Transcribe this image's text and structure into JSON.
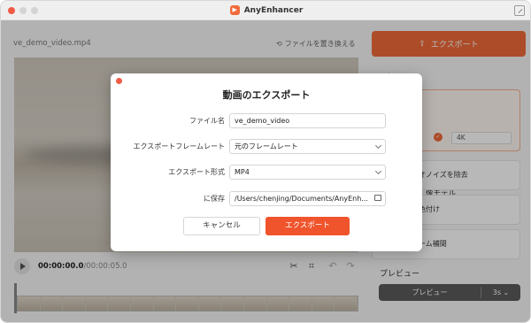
{
  "window": {
    "app_title": "AnyEnhancer",
    "colors": {
      "close": "#f15a47",
      "minimize": "#d4d4d4",
      "maximize": "#d4d4d4",
      "accent": "#f06a3a"
    }
  },
  "editor": {
    "file_name": "ve_demo_video.mp4",
    "replace_file": "ファイルを置き換える",
    "current_time": "00:00:00.0",
    "total_time": "/00:00:05.0"
  },
  "right_panel": {
    "export_button": "エクスポート",
    "selection_heading": "選択",
    "model_title": "像モデル",
    "resolution": "4K",
    "option_denoise": "オノイズを除去",
    "option_colorize": "色付け",
    "option_interpolate": "ーム補間",
    "preview_heading": "プレビュー",
    "preview_button": "プレビュー",
    "preview_duration": "3s"
  },
  "dialog": {
    "title": "動画のエクスポート",
    "filename_label": "ファイル名",
    "filename_value": "ve_demo_video",
    "framerate_label": "エクスポートフレームレート",
    "framerate_value": "元のフレームレート",
    "format_label": "エクスポート形式",
    "format_value": "MP4",
    "save_label": "に保存",
    "save_path": "/Users/chenjing/Documents/AnyEnh...",
    "cancel_button": "キャンセル",
    "export_button": "エクスポート"
  }
}
